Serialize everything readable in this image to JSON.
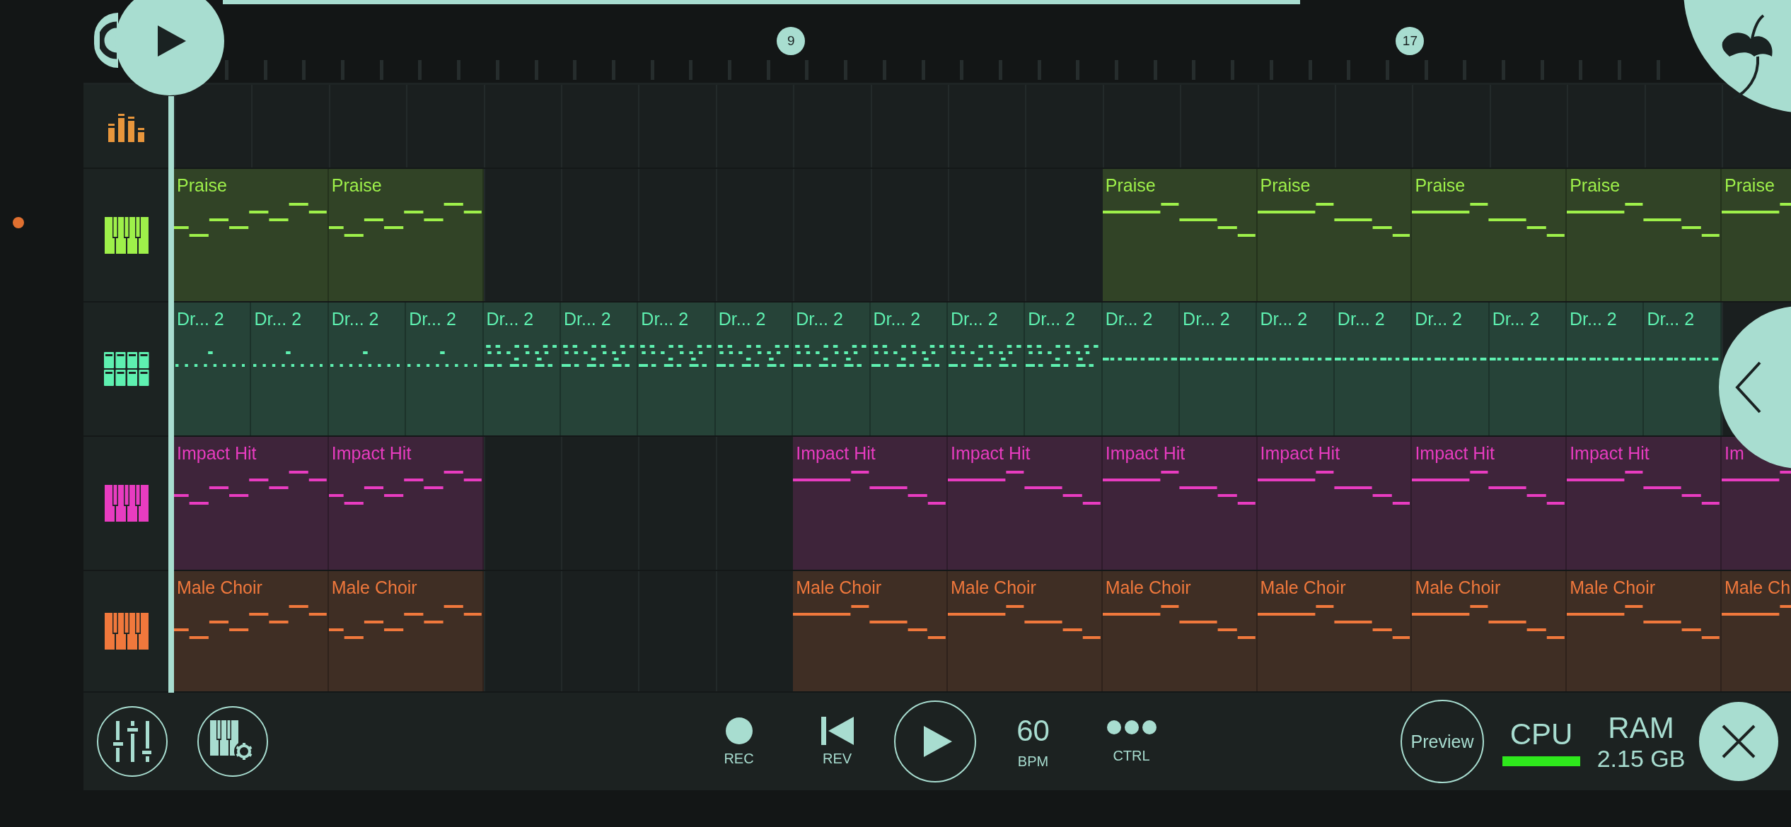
{
  "ruler": {
    "markers": [
      {
        "label": "9"
      },
      {
        "label": "17"
      }
    ]
  },
  "tracks": [
    {
      "kind": "mixer",
      "color": "#e8963c"
    },
    {
      "kind": "keys",
      "color": "#9ef04a",
      "clips": [
        {
          "kind": "rise",
          "label": "Praise"
        },
        {
          "kind": "rise",
          "label": "Praise"
        },
        {
          "kind": "gap"
        },
        {
          "kind": "gap"
        },
        {
          "kind": "gap"
        },
        {
          "kind": "gap"
        },
        {
          "kind": "fall",
          "label": "Praise"
        },
        {
          "kind": "fall",
          "label": "Praise"
        },
        {
          "kind": "fall",
          "label": "Praise"
        },
        {
          "kind": "fall",
          "label": "Praise"
        },
        {
          "kind": "fall",
          "label": "Praise"
        }
      ]
    },
    {
      "kind": "drums",
      "color": "#5ef0b0",
      "clips": [
        {
          "kind": "sparse",
          "label": "Dr... 2"
        },
        {
          "kind": "sparse",
          "label": "Dr... 2"
        },
        {
          "kind": "sparse",
          "label": "Dr... 2"
        },
        {
          "kind": "sparse",
          "label": "Dr... 2"
        },
        {
          "kind": "dense",
          "label": "Dr... 2"
        },
        {
          "kind": "dense",
          "label": "Dr... 2"
        },
        {
          "kind": "dense",
          "label": "Dr... 2"
        },
        {
          "kind": "dense",
          "label": "Dr... 2"
        },
        {
          "kind": "dense",
          "label": "Dr... 2"
        },
        {
          "kind": "dense",
          "label": "Dr... 2"
        },
        {
          "kind": "dense",
          "label": "Dr... 2"
        },
        {
          "kind": "dense",
          "label": "Dr... 2"
        },
        {
          "kind": "steady",
          "label": "Dr... 2"
        },
        {
          "kind": "steady",
          "label": "Dr... 2"
        },
        {
          "kind": "steady",
          "label": "Dr... 2"
        },
        {
          "kind": "steady",
          "label": "Dr... 2"
        },
        {
          "kind": "steady",
          "label": "Dr... 2"
        },
        {
          "kind": "steady",
          "label": "Dr... 2"
        },
        {
          "kind": "steady",
          "label": "Dr... 2"
        },
        {
          "kind": "steady",
          "label": "Dr... 2"
        }
      ]
    },
    {
      "kind": "keys",
      "color": "#e83cc0",
      "clips": [
        {
          "kind": "rise",
          "label": "Impact Hit"
        },
        {
          "kind": "rise",
          "label": "Impact Hit"
        },
        {
          "kind": "gap"
        },
        {
          "kind": "gap"
        },
        {
          "kind": "fall",
          "label": "Impact Hit"
        },
        {
          "kind": "fall",
          "label": "Impact Hit"
        },
        {
          "kind": "fall",
          "label": "Impact Hit"
        },
        {
          "kind": "fall",
          "label": "Impact Hit"
        },
        {
          "kind": "fall",
          "label": "Impact Hit"
        },
        {
          "kind": "fall",
          "label": "Impact Hit"
        },
        {
          "kind": "fall",
          "label": "Im"
        }
      ]
    },
    {
      "kind": "keys",
      "color": "#f0783c",
      "clips": [
        {
          "kind": "rise",
          "label": "Male Choir"
        },
        {
          "kind": "rise",
          "label": "Male Choir"
        },
        {
          "kind": "gap"
        },
        {
          "kind": "gap"
        },
        {
          "kind": "fall",
          "label": "Male Choir"
        },
        {
          "kind": "fall",
          "label": "Male Choir"
        },
        {
          "kind": "fall",
          "label": "Male Choir"
        },
        {
          "kind": "fall",
          "label": "Male Choir"
        },
        {
          "kind": "fall",
          "label": "Male Choir"
        },
        {
          "kind": "fall",
          "label": "Male Choir"
        },
        {
          "kind": "fall",
          "label": "Male Ch"
        }
      ]
    }
  ],
  "toolbar": {
    "rec": {
      "label": "REC"
    },
    "rev": {
      "label": "REV"
    },
    "tempo": {
      "value": "60",
      "label": "BPM"
    },
    "ctrl": {
      "label": "CTRL"
    },
    "preview": {
      "label": "Preview"
    },
    "cpu": {
      "label": "CPU",
      "level": 1
    },
    "ram": {
      "label": "RAM",
      "value": "2.15 GB"
    }
  }
}
